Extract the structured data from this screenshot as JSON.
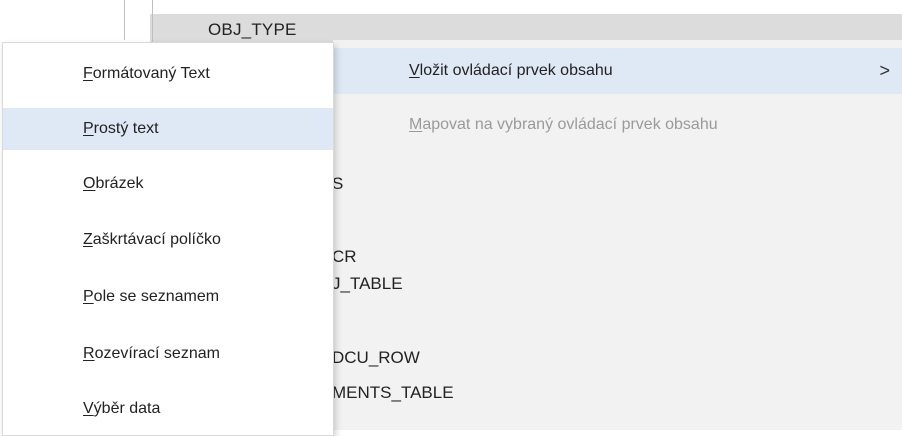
{
  "document": {
    "header": "OBJ_TYPE",
    "lines": [
      {
        "id": "line1",
        "text": "S"
      },
      {
        "id": "line2",
        "text": "CR"
      },
      {
        "id": "line3",
        "text": "J_TABLE"
      },
      {
        "id": "line4",
        "text": "DCU_ROW"
      },
      {
        "id": "line5",
        "text": "MENTS_TABLE"
      }
    ]
  },
  "context_menu": {
    "items": [
      {
        "accel": "F",
        "rest": "ormátovaný Text"
      },
      {
        "accel": "P",
        "rest": "rostý text"
      },
      {
        "accel": "O",
        "rest": "brázek"
      },
      {
        "accel": "Z",
        "rest": "aškrtávací políčko"
      },
      {
        "accel": "P",
        "rest": "ole se seznamem"
      },
      {
        "accel": "R",
        "rest": "ozevírací seznam"
      },
      {
        "accel": "V",
        "rest": "ýběr data"
      }
    ]
  },
  "submenu": {
    "insert_accel": "V",
    "insert_rest": "ložit ovládací prvek obsahu",
    "chevron": ">",
    "map_accel": "M",
    "map_rest": "apovat na vybraný ovládací prvek obsahu"
  },
  "colors": {
    "highlight": "#dfe8f5",
    "disabled_text": "#9a9a9a",
    "doc_background": "#f2f2f2"
  }
}
